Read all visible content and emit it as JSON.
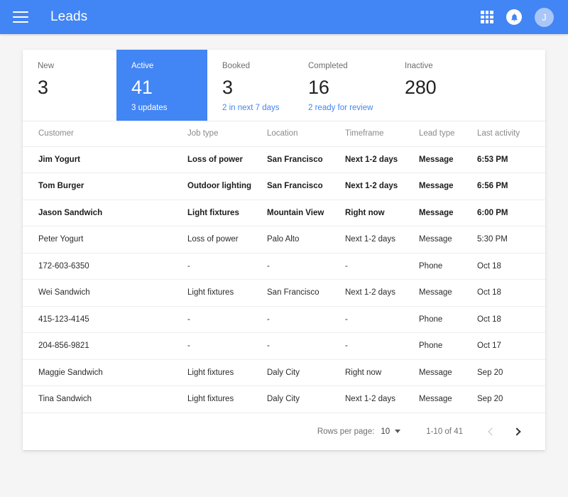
{
  "appbar": {
    "menu_icon": "hamburger-menu-icon",
    "title": "Leads",
    "apps_icon": "apps-grid-icon",
    "notifications_icon": "notification-bell-icon",
    "avatar_initial": "J",
    "background_color": "#4285f4"
  },
  "stats": [
    {
      "label": "New",
      "value": "3",
      "sub": "",
      "selected": false
    },
    {
      "label": "Active",
      "value": "41",
      "sub": "3 updates",
      "selected": true
    },
    {
      "label": "Booked",
      "value": "3",
      "sub": "2 in next 7 days",
      "selected": false
    },
    {
      "label": "Completed",
      "value": "16",
      "sub": "2 ready for review",
      "selected": false
    },
    {
      "label": "Inactive",
      "value": "280",
      "sub": "",
      "selected": false
    }
  ],
  "table": {
    "columns": [
      "Customer",
      "Job type",
      "Location",
      "Timeframe",
      "Lead type",
      "Last activity"
    ],
    "rows": [
      {
        "customer": "Jim Yogurt",
        "job": "Loss of power",
        "location": "San Francisco",
        "timeframe": "Next 1-2 days",
        "lead": "Message",
        "activity": "6:53 PM",
        "unread": true
      },
      {
        "customer": "Tom Burger",
        "job": "Outdoor lighting",
        "location": "San Francisco",
        "timeframe": "Next 1-2 days",
        "lead": "Message",
        "activity": "6:56 PM",
        "unread": true
      },
      {
        "customer": "Jason Sandwich",
        "job": "Light fixtures",
        "location": "Mountain View",
        "timeframe": "Right now",
        "lead": "Message",
        "activity": "6:00 PM",
        "unread": true
      },
      {
        "customer": "Peter Yogurt",
        "job": "Loss of power",
        "location": "Palo Alto",
        "timeframe": "Next 1-2 days",
        "lead": "Message",
        "activity": "5:30 PM",
        "unread": false
      },
      {
        "customer": "172-603-6350",
        "job": "-",
        "location": "-",
        "timeframe": "-",
        "lead": "Phone",
        "activity": "Oct 18",
        "unread": false
      },
      {
        "customer": "Wei Sandwich",
        "job": "Light fixtures",
        "location": "San Francisco",
        "timeframe": "Next 1-2 days",
        "lead": "Message",
        "activity": "Oct 18",
        "unread": false
      },
      {
        "customer": "415-123-4145",
        "job": "-",
        "location": "-",
        "timeframe": "-",
        "lead": "Phone",
        "activity": "Oct 18",
        "unread": false
      },
      {
        "customer": "204-856-9821",
        "job": "-",
        "location": "-",
        "timeframe": "-",
        "lead": "Phone",
        "activity": "Oct 17",
        "unread": false
      },
      {
        "customer": "Maggie Sandwich",
        "job": "Light fixtures",
        "location": "Daly City",
        "timeframe": "Right now",
        "lead": "Message",
        "activity": "Sep 20",
        "unread": false
      },
      {
        "customer": "Tina Sandwich",
        "job": "Light fixtures",
        "location": "Daly City",
        "timeframe": "Next 1-2 days",
        "lead": "Message",
        "activity": "Sep 20",
        "unread": false
      }
    ]
  },
  "footer": {
    "rows_per_page_label": "Rows per page:",
    "rows_per_page_value": "10",
    "range_label": "1-10 of 41",
    "prev_icon": "chevron-left-icon",
    "next_icon": "chevron-right-icon"
  }
}
